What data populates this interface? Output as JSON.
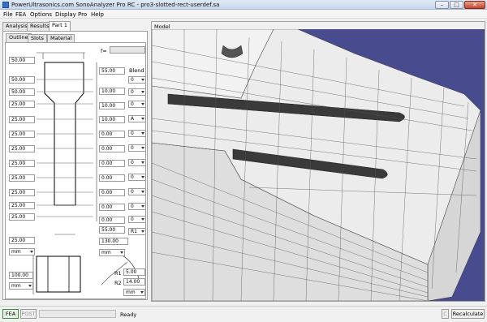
{
  "window": {
    "title": "PowerUltrasonics.com SonoAnalyzer Pro RC - pro3-slotted-rect-userdef.sa",
    "minimize": "–",
    "maximize": "□",
    "close": "✕"
  },
  "menu": [
    "File",
    "FEA",
    "Options",
    "Display",
    "Pro",
    "Help"
  ],
  "tabs_top": [
    "Analysis",
    "Results",
    "Part 1"
  ],
  "tabs_sub": [
    "Outline",
    "Slots",
    "Material"
  ],
  "f_label": "f=",
  "f_value": "",
  "top_width": "50.00",
  "left_dims": [
    "50.00",
    "50.00",
    "25.00",
    "25.00",
    "25.00",
    "25.00",
    "25.00",
    "25.00",
    "25.00",
    "25.00",
    "25.00"
  ],
  "right_dims": [
    "55.00",
    "10.00",
    "10.00",
    "10.00",
    "0.00",
    "0.00",
    "0.00",
    "0.00",
    "0.00",
    "0.00",
    "0.00",
    "55.00"
  ],
  "blend_label": "Blend",
  "blend_values": [
    "0",
    "0",
    "0",
    "A",
    "0",
    "0",
    "0",
    "0",
    "0",
    "0",
    "0",
    "0",
    "R1"
  ],
  "bottom_width": "25.00",
  "unit_mm": "mm",
  "length_value": "130.00",
  "section_width": "100.00",
  "r1_label": "R1",
  "r1_value": "5.00",
  "r2_label": "R2",
  "r2_value": "14.00",
  "model_label": "Model",
  "status": {
    "fea": "FEA",
    "post": "POST",
    "progress": 0,
    "text": "Ready",
    "c_button": "C",
    "recalculate": "Recalculate"
  },
  "colors": {
    "viewport_bg": "#484c8f",
    "mesh_face": "#ececec",
    "mesh_line": "#444444"
  }
}
